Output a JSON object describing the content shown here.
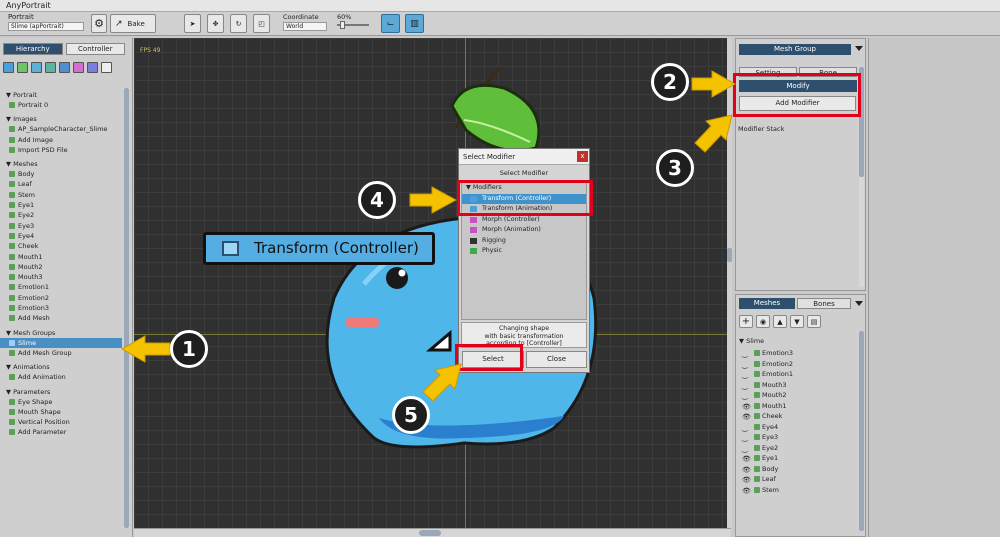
{
  "window": {
    "title": "AnyPortrait"
  },
  "toolbar": {
    "portrait_label": "Portrait",
    "portrait_value": "Slime (apPortrait)",
    "bake_label": "Bake",
    "coordinate_label": "Coordinate",
    "coordinate_value": "World",
    "zoom_label": "60%"
  },
  "left": {
    "tabs": [
      "Hierarchy",
      "Controller"
    ],
    "sections": [
      {
        "title": "Portrait",
        "items": [
          "Portrait 0"
        ]
      },
      {
        "title": "Images",
        "items": [
          "AP_SampleCharacter_Slime",
          "Add Image",
          "Import PSD File"
        ]
      },
      {
        "title": "Meshes",
        "items": [
          "Body",
          "Leaf",
          "Stem",
          "Eye1",
          "Eye2",
          "Eye3",
          "Eye4",
          "Cheek",
          "Mouth1",
          "Mouth2",
          "Mouth3",
          "Emotion1",
          "Emotion2",
          "Emotion3",
          "Add Mesh"
        ]
      },
      {
        "title": "Mesh Groups",
        "items": [
          "Slime",
          "Add Mesh Group"
        ]
      },
      {
        "title": "Animations",
        "items": [
          "Add Animation"
        ]
      },
      {
        "title": "Parameters",
        "items": [
          "Eye Shape",
          "Mouth Shape",
          "Vertical Position",
          "Add Parameter"
        ]
      }
    ]
  },
  "viewport": {
    "fps": "FPS 49"
  },
  "badge": {
    "text": "Transform (Controller)"
  },
  "dialog": {
    "title": "Select Modifier",
    "subtitle": "Select Modifier",
    "group": "Modifiers",
    "items": [
      "Transform (Controller)",
      "Transform (Animation)",
      "Morph (Controller)",
      "Morph (Animation)",
      "Rigging",
      "Physic"
    ],
    "desc_line1": "Changing shape",
    "desc_line2": "with basic transformation",
    "desc_line3": "according to [Controller]",
    "select_label": "Select",
    "close_label": "Close"
  },
  "right_top": {
    "header": "Mesh Group",
    "tab_setting": "Setting",
    "tab_bone": "Bone",
    "modify_label": "Modify",
    "add_modifier_label": "Add Modifier",
    "stack_label": "Modifier Stack"
  },
  "right_bottom": {
    "tabs": [
      "Meshes",
      "Bones"
    ],
    "root": "Slime",
    "items": [
      "Emotion3",
      "Emotion2",
      "Emotion1",
      "Mouth3",
      "Mouth2",
      "Mouth1",
      "Cheek",
      "Eye4",
      "Eye3",
      "Eye2",
      "Eye1",
      "Body",
      "Leaf",
      "Stem"
    ],
    "visible": [
      false,
      false,
      false,
      false,
      false,
      true,
      true,
      false,
      false,
      false,
      true,
      true,
      true,
      true
    ]
  },
  "callouts": [
    "1",
    "2",
    "3",
    "4",
    "5"
  ],
  "colors": {
    "accent": "#4a8fc4",
    "callout_arrow": "#f5c200",
    "highlight_box": "#e2001a",
    "viewport_bg": "#303030"
  }
}
